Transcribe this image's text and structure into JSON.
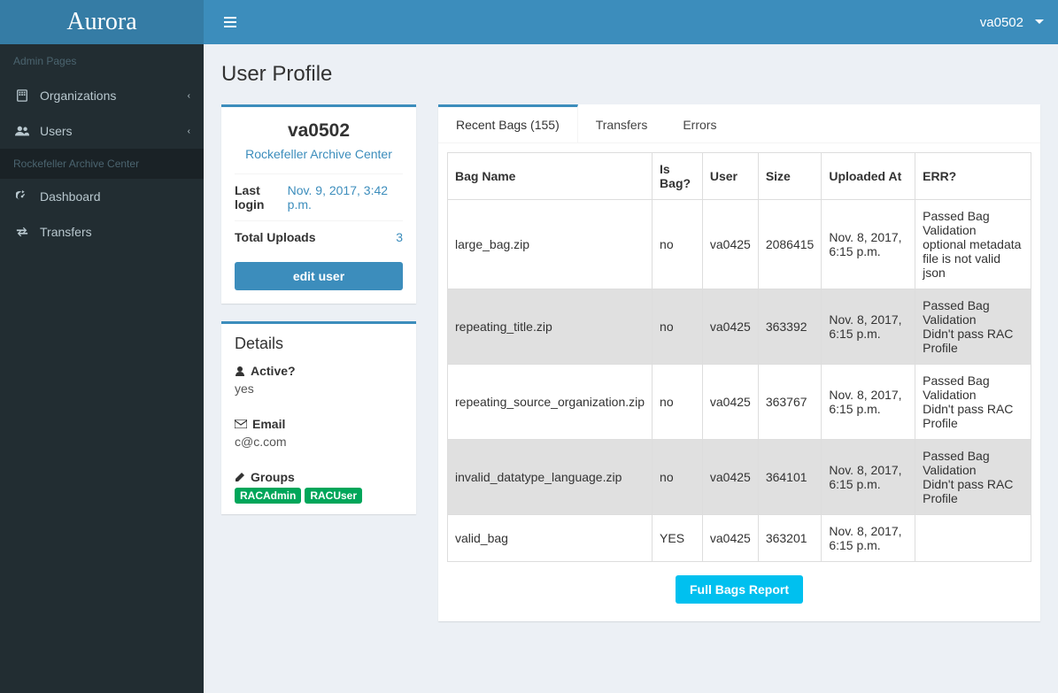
{
  "brand": "Aurora",
  "topbar": {
    "user": "va0502"
  },
  "sidebar": {
    "admin_header": "Admin Pages",
    "organizations": "Organizations",
    "users": "Users",
    "section": "Rockefeller Archive Center",
    "dashboard": "Dashboard",
    "transfers": "Transfers"
  },
  "page": {
    "title": "User Profile"
  },
  "profile": {
    "username": "va0502",
    "org": "Rockefeller Archive Center",
    "last_login_label": "Last login",
    "last_login": "Nov. 9, 2017, 3:42 p.m.",
    "total_uploads_label": "Total Uploads",
    "total_uploads": "3",
    "edit_button": "edit user"
  },
  "details": {
    "title": "Details",
    "active_label": "Active?",
    "active_value": "yes",
    "email_label": "Email",
    "email_value": "c@c.com",
    "groups_label": "Groups",
    "groups": [
      "RACAdmin",
      "RACUser"
    ]
  },
  "tabs": {
    "recent": "Recent Bags (155)",
    "transfers": "Transfers",
    "errors": "Errors"
  },
  "table": {
    "headers": {
      "bag_name": "Bag Name",
      "is_bag": "Is Bag?",
      "user": "User",
      "size": "Size",
      "uploaded_at": "Uploaded At",
      "err": "ERR?"
    },
    "rows": [
      {
        "name": "large_bag.zip",
        "is_bag": "no",
        "user": "va0425",
        "size": "2086415",
        "uploaded": "Nov. 8, 2017, 6:15 p.m.",
        "err": "Passed Bag Validation\noptional metadata file is not valid json"
      },
      {
        "name": "repeating_title.zip",
        "is_bag": "no",
        "user": "va0425",
        "size": "363392",
        "uploaded": "Nov. 8, 2017, 6:15 p.m.",
        "err": "Passed Bag Validation\nDidn't pass RAC Profile"
      },
      {
        "name": "repeating_source_organization.zip",
        "is_bag": "no",
        "user": "va0425",
        "size": "363767",
        "uploaded": "Nov. 8, 2017, 6:15 p.m.",
        "err": "Passed Bag Validation\nDidn't pass RAC Profile"
      },
      {
        "name": "invalid_datatype_language.zip",
        "is_bag": "no",
        "user": "va0425",
        "size": "364101",
        "uploaded": "Nov. 8, 2017, 6:15 p.m.",
        "err": "Passed Bag Validation\nDidn't pass RAC Profile"
      },
      {
        "name": "valid_bag",
        "is_bag": "YES",
        "user": "va0425",
        "size": "363201",
        "uploaded": "Nov. 8, 2017, 6:15 p.m.",
        "err": ""
      }
    ],
    "full_report": "Full Bags Report"
  }
}
